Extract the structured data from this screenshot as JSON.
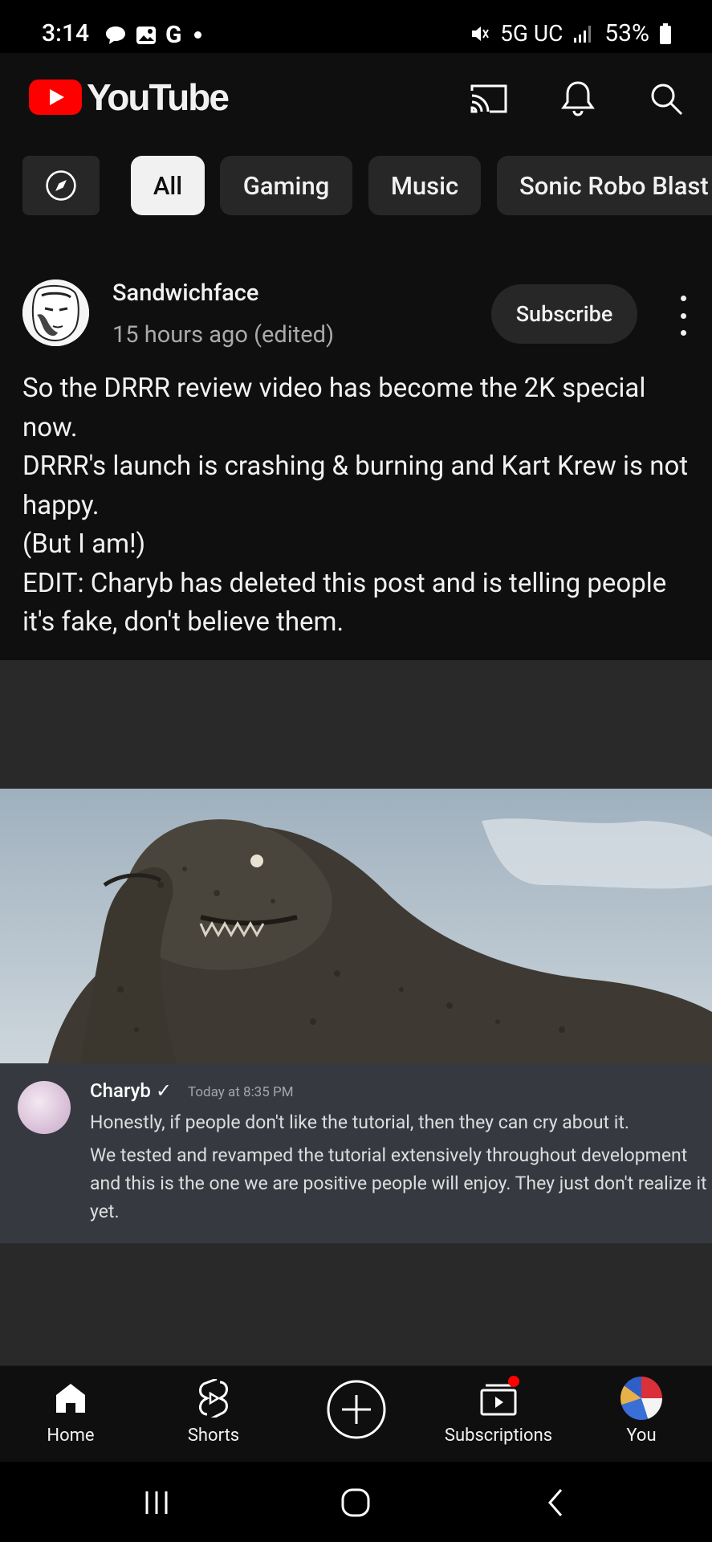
{
  "status_bar": {
    "time": "3:14",
    "network": "5G UC",
    "battery": "53%"
  },
  "app": {
    "logo_text": "YouTube",
    "brand_color": "#ff0000"
  },
  "chips": [
    {
      "label": "",
      "icon": "compass-icon"
    },
    {
      "label": "All",
      "active": true
    },
    {
      "label": "Gaming"
    },
    {
      "label": "Music"
    },
    {
      "label": "Sonic Robo Blast"
    }
  ],
  "post": {
    "author": "Sandwichface",
    "time": "15 hours ago (edited)",
    "subscribe_label": "Subscribe",
    "lines": [
      "So the DRRR review video has become the 2K special now.",
      "DRRR's launch is crashing & burning and Kart Krew is not happy.",
      "(But I am!)",
      "EDIT: Charyb has deleted this post and is telling people it's fake, don't believe them."
    ]
  },
  "discord_message": {
    "username": "Charyb ✓",
    "timestamp": "Today at 8:35 PM",
    "line1": "Honestly, if people don't like the tutorial, then they can cry about it.",
    "line2": "We tested and revamped the tutorial extensively throughout development and this is the one we are positive people will enjoy. They just don't realize it yet."
  },
  "bottom_nav": {
    "home": "Home",
    "shorts": "Shorts",
    "subscriptions": "Subscriptions",
    "you": "You"
  }
}
